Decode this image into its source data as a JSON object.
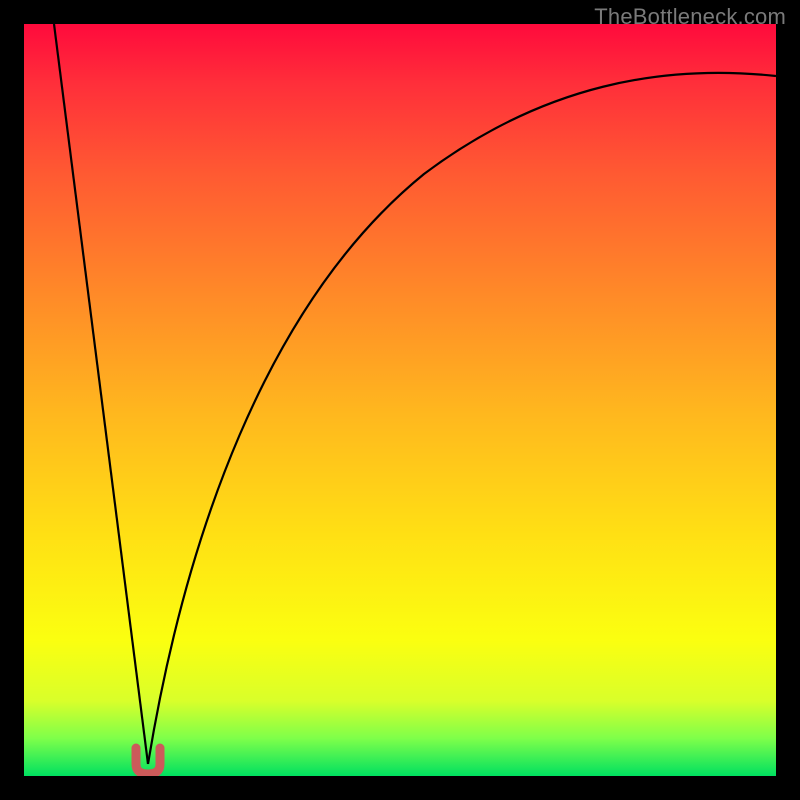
{
  "watermark": "TheBottleneck.com",
  "colors": {
    "frame": "#000000",
    "curve": "#000000",
    "marker": "#cc5a5a",
    "gradient_top": "#ff0a3c",
    "gradient_bottom": "#00e060"
  },
  "chart_data": {
    "type": "line",
    "title": "",
    "xlabel": "",
    "ylabel": "",
    "xlim": [
      0,
      100
    ],
    "ylim": [
      0,
      100
    ],
    "annotations": [
      "U-shaped marker at curve minimum"
    ],
    "series": [
      {
        "name": "left-branch",
        "x": [
          4,
          6,
          8,
          10,
          12,
          14,
          15,
          16
        ],
        "values": [
          100,
          83,
          66,
          49,
          32,
          15,
          7,
          0
        ]
      },
      {
        "name": "right-branch",
        "x": [
          16,
          18,
          20,
          24,
          28,
          34,
          42,
          52,
          64,
          78,
          92,
          100
        ],
        "values": [
          0,
          14,
          25,
          40,
          51,
          62,
          72,
          79,
          85,
          89,
          92,
          93
        ]
      }
    ],
    "marker": {
      "x": 16,
      "y": 2,
      "shape": "U",
      "color": "#cc5a5a"
    }
  }
}
